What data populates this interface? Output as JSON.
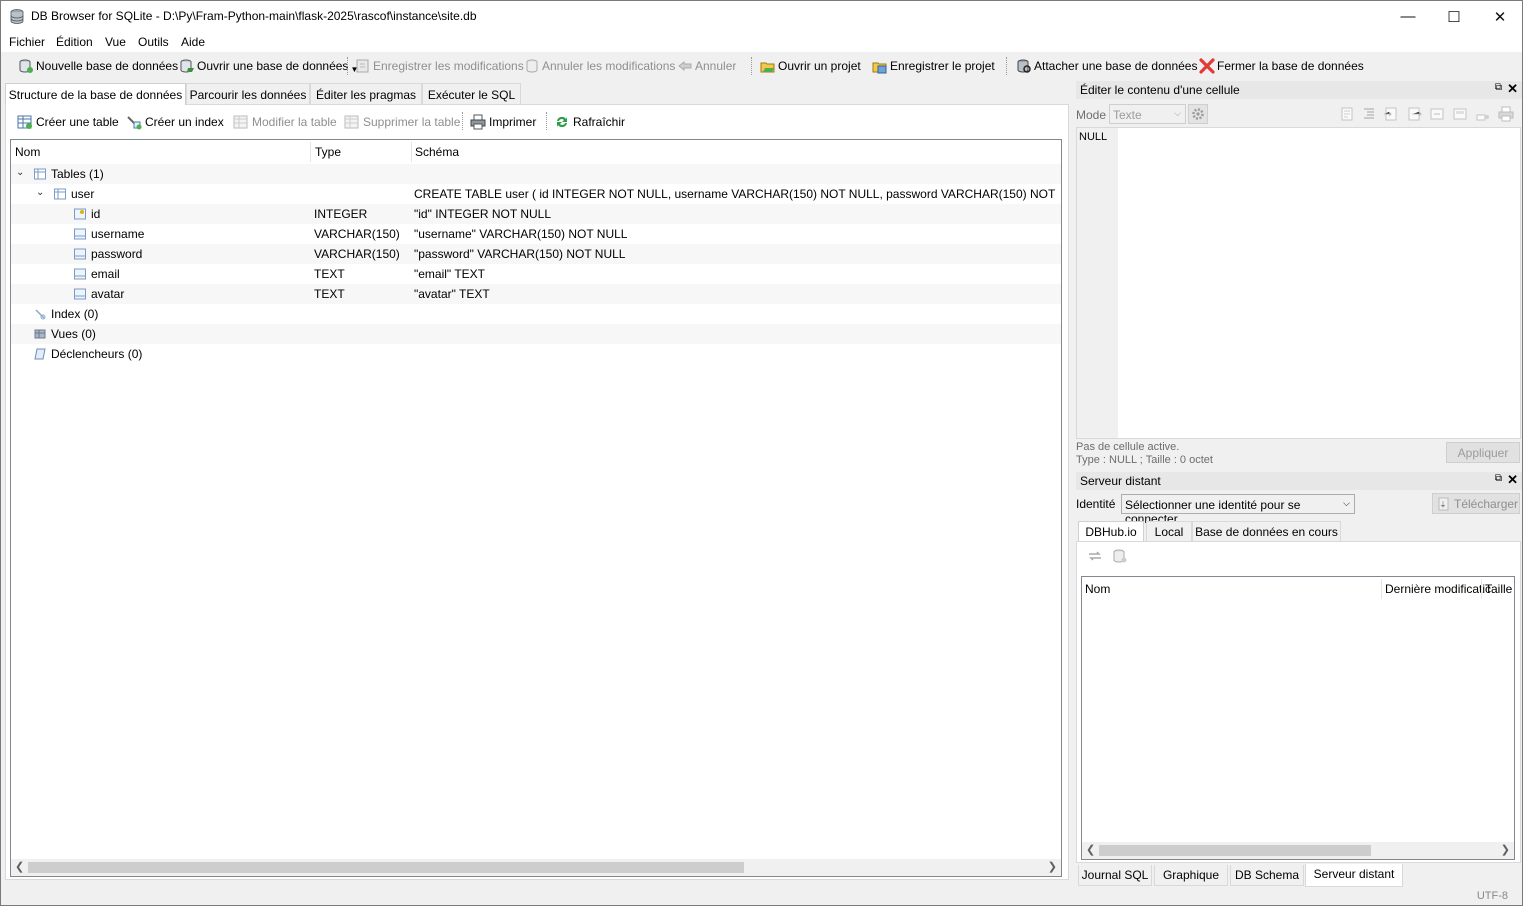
{
  "window": {
    "title": "DB Browser for SQLite - D:\\Py\\Fram-Python-main\\flask-2025\\rascof\\instance\\site.db",
    "controls": {
      "minimize": "—",
      "maximize": "☐",
      "close": "✕"
    }
  },
  "menu": [
    "Fichier",
    "Édition",
    "Vue",
    "Outils",
    "Aide"
  ],
  "toolbar": {
    "new_db": "Nouvelle base de données",
    "open_db": "Ouvrir une base de données",
    "write_changes": "Enregistrer les modifications",
    "revert_changes": "Annuler les modifications",
    "undo": "Annuler",
    "open_project": "Ouvrir un projet",
    "save_project": "Enregistrer le projet",
    "attach_db": "Attacher une base de données",
    "close_db": "Fermer la base de données"
  },
  "main_tabs": [
    "Structure de la base de données",
    "Parcourir les données",
    "Éditer les pragmas",
    "Exécuter le SQL"
  ],
  "structure_toolbar": {
    "create_table": "Créer une table",
    "create_index": "Créer un index",
    "modify_table": "Modifier la table",
    "delete_table": "Supprimer la table",
    "print": "Imprimer",
    "refresh": "Rafraîchir"
  },
  "tree": {
    "headers": {
      "name": "Nom",
      "type": "Type",
      "schema": "Schéma"
    },
    "tables_node": "Tables (1)",
    "table": {
      "name": "user",
      "schema": "CREATE TABLE user ( id INTEGER NOT NULL, username VARCHAR(150) NOT NULL, password VARCHAR(150) NOT"
    },
    "columns": [
      {
        "name": "id",
        "type": "INTEGER",
        "schema": "\"id\" INTEGER NOT NULL"
      },
      {
        "name": "username",
        "type": "VARCHAR(150)",
        "schema": "\"username\" VARCHAR(150) NOT NULL"
      },
      {
        "name": "password",
        "type": "VARCHAR(150)",
        "schema": "\"password\" VARCHAR(150) NOT NULL"
      },
      {
        "name": "email",
        "type": "TEXT",
        "schema": "\"email\" TEXT"
      },
      {
        "name": "avatar",
        "type": "TEXT",
        "schema": "\"avatar\" TEXT"
      }
    ],
    "index_node": "Index (0)",
    "views_node": "Vues (0)",
    "triggers_node": "Déclencheurs (0)"
  },
  "edit_cell": {
    "title": "Éditer le contenu d'une cellule",
    "mode_label": "Mode :",
    "mode_value": "Texte",
    "null_label": "NULL",
    "status_line1": "Pas de cellule active.",
    "status_line2": "Type : NULL ; Taille : 0 octet",
    "apply": "Appliquer"
  },
  "remote": {
    "title": "Serveur distant",
    "identity_label": "Identité",
    "identity_value": "Sélectionner une identité pour se connecter",
    "download": "Télécharger",
    "tabs": [
      "DBHub.io",
      "Local",
      "Base de données en cours"
    ],
    "headers": {
      "name": "Nom",
      "modified": "Dernière modificatic",
      "size": "Taille"
    }
  },
  "bottom_tabs": [
    "Journal SQL",
    "Graphique",
    "DB Schema",
    "Serveur distant"
  ],
  "status": {
    "encoding": "UTF-8"
  }
}
